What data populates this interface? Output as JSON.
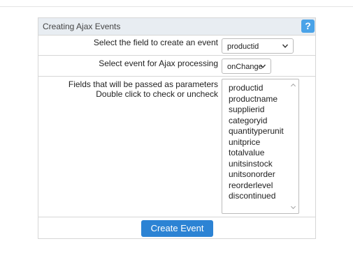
{
  "panel": {
    "title": "Creating Ajax Events",
    "help_label": "?"
  },
  "field_row": {
    "label": "Select the field to create an event",
    "selected": "productid"
  },
  "event_row": {
    "label": "Select event for Ajax processing",
    "selected": "onChange"
  },
  "params_row": {
    "label_line1": "Fields that will be passed as parameters",
    "label_line2": "Double click to check or uncheck",
    "fields": [
      "productid",
      "productname",
      "supplierid",
      "categoryid",
      "quantityperunit",
      "unitprice",
      "totalvalue",
      "unitsinstock",
      "unitsonorder",
      "reorderlevel",
      "discontinued"
    ]
  },
  "actions": {
    "create_label": "Create Event"
  },
  "icons": {
    "help": "question-icon",
    "dropdown": "chevron-down-icon",
    "scroll_up": "scroll-up-arrow-icon",
    "scroll_down": "scroll-down-arrow-icon"
  },
  "colors": {
    "header_bg": "#e8edf2",
    "help_button": "#4aa3e8",
    "primary_button": "#2c83d4",
    "border": "#d6d6d6"
  }
}
